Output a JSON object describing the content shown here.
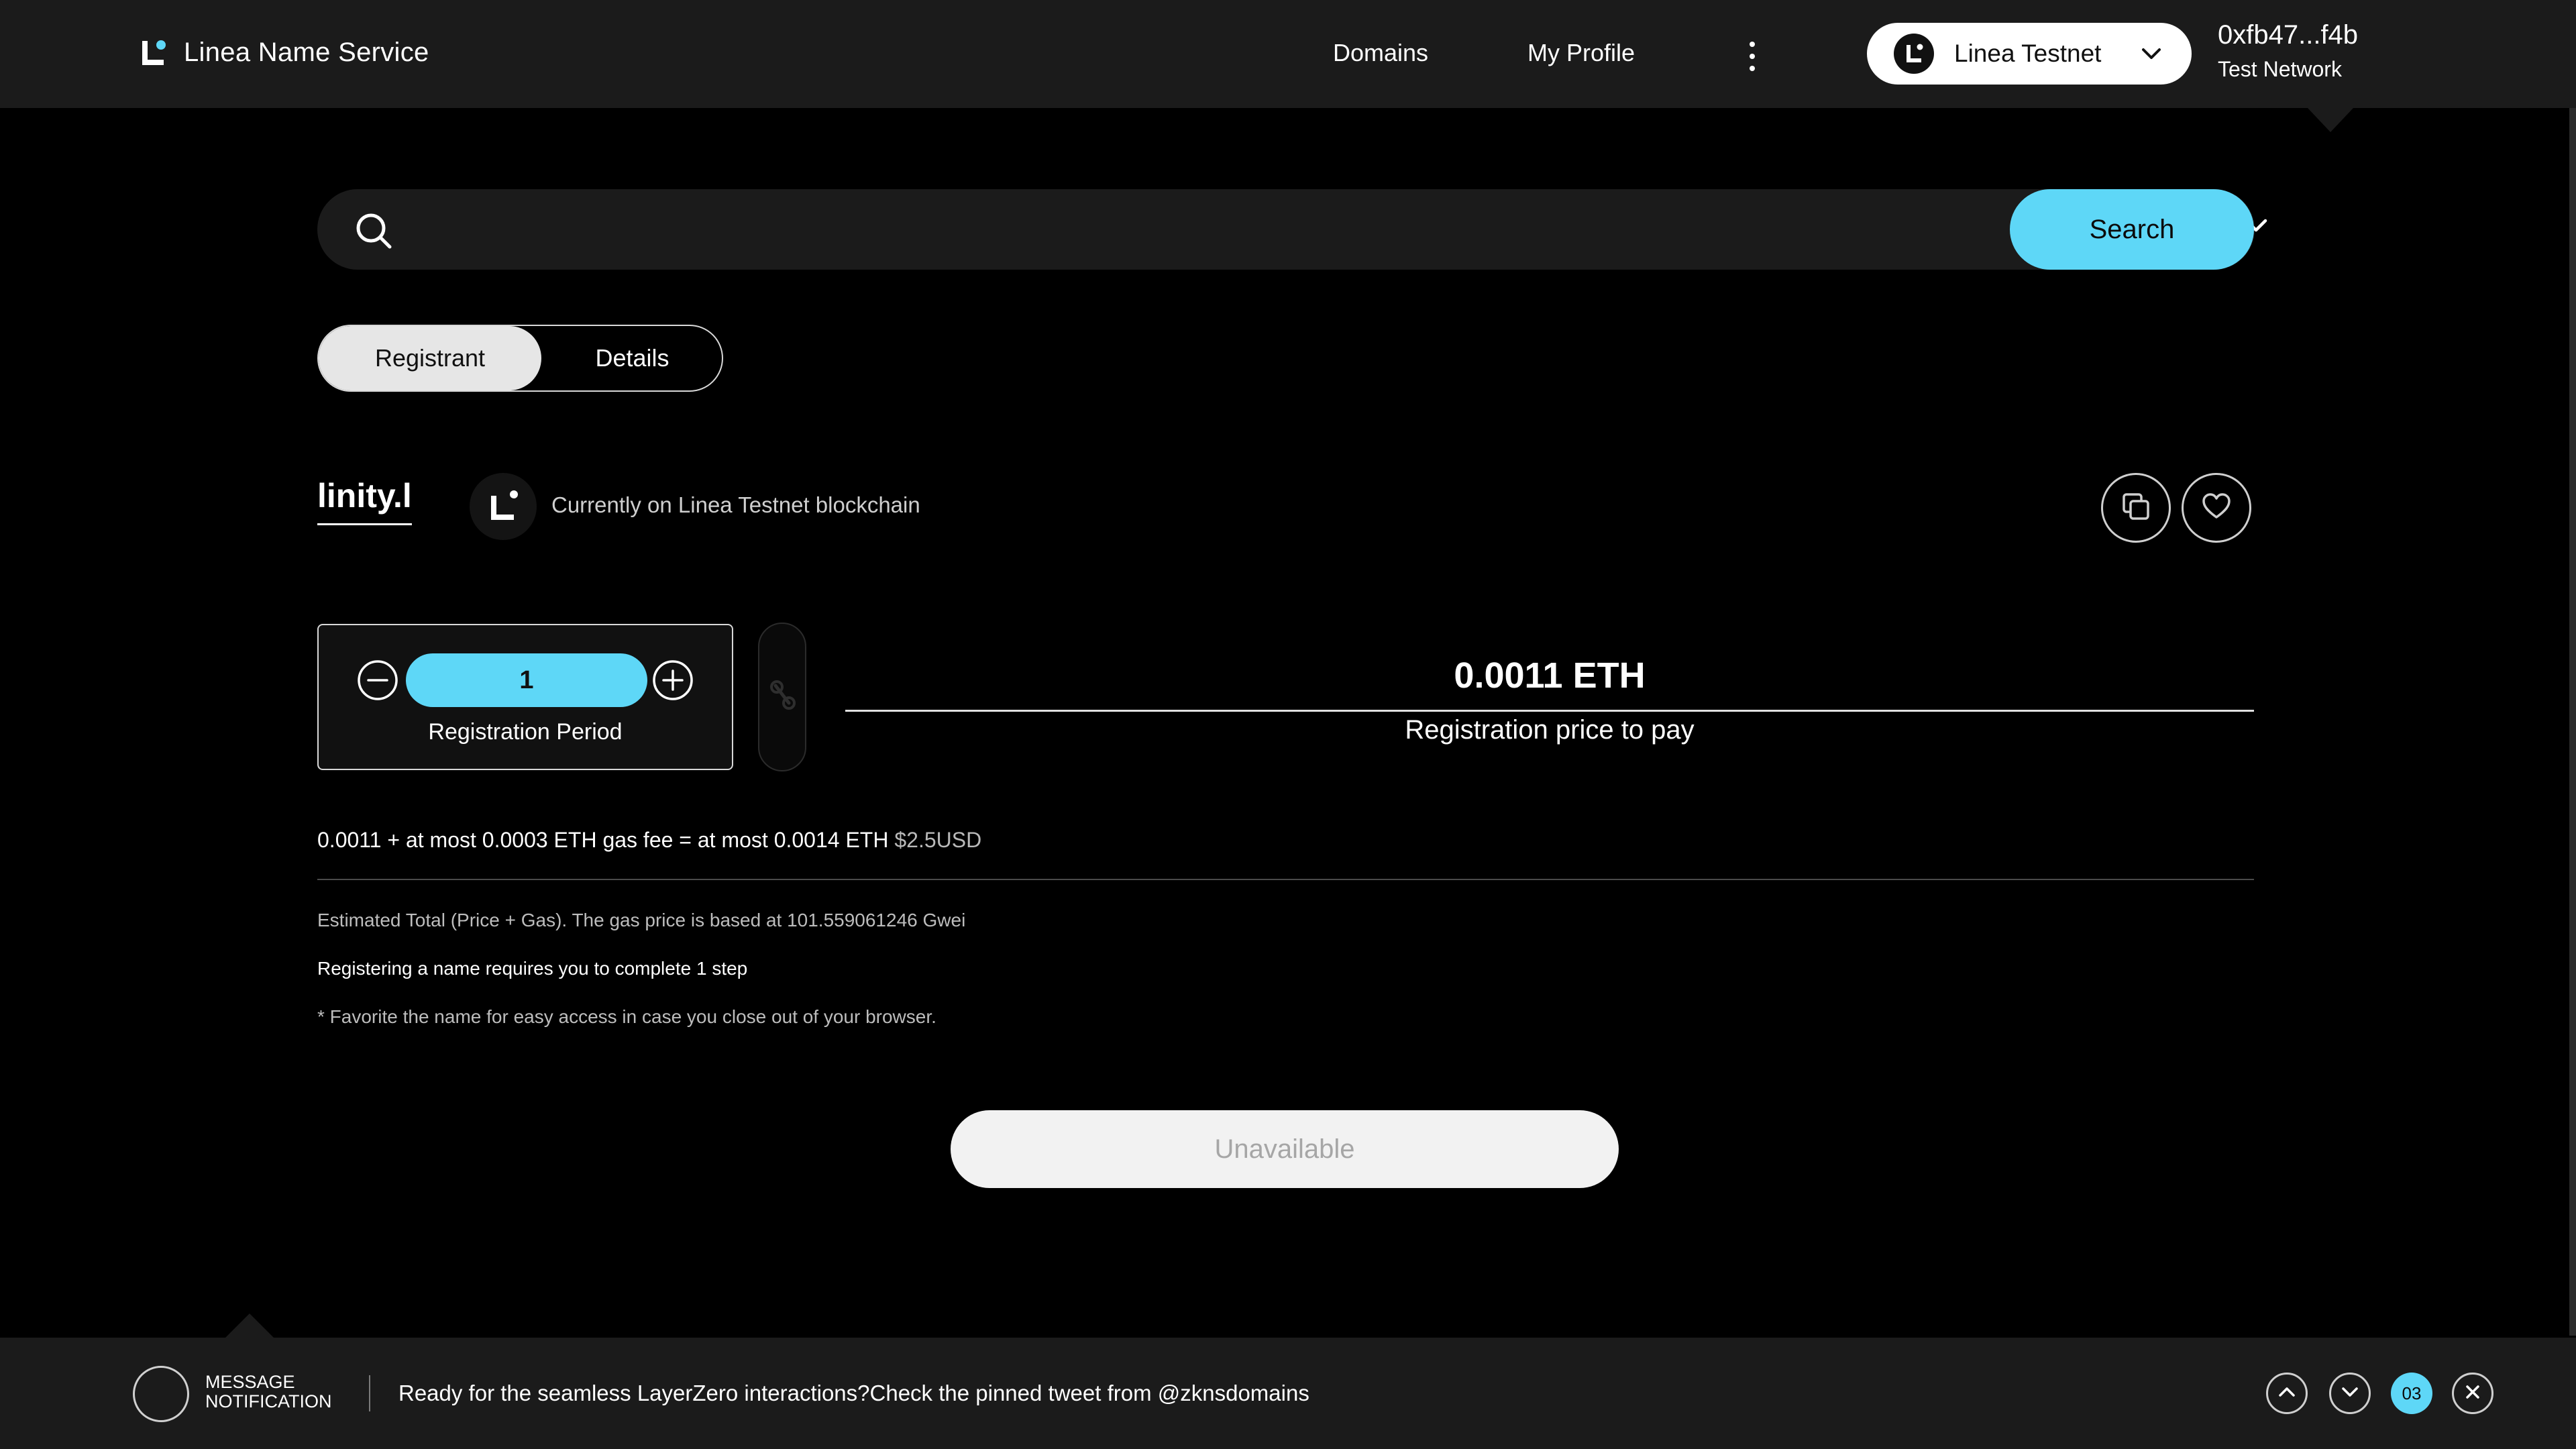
{
  "header": {
    "brand": "Linea Name Service",
    "nav": {
      "domains": "Domains",
      "profile": "My Profile"
    },
    "network_selector": {
      "label": "Linea Testnet"
    },
    "wallet": {
      "address": "0xfb47...f4b",
      "network": "Test Network"
    }
  },
  "search": {
    "query": "",
    "tld": ".l",
    "button_label": "Search"
  },
  "tabs": {
    "registrant": "Registrant",
    "details": "Details",
    "active": "Registrant"
  },
  "domain": {
    "name": "linity.l",
    "chain_text": "Currently on Linea Testnet blockchain"
  },
  "registration": {
    "period_value": "1",
    "period_label": "Registration Period",
    "price": "0.0011 ETH",
    "price_label": "Registration price to pay"
  },
  "fees": {
    "summary": "0.0011 + at most 0.0003 ETH gas fee = at most 0.0014 ETH",
    "usd": "$2.5USD",
    "gas_note": "Estimated Total (Price + Gas). The gas price is based at 101.559061246 Gwei",
    "steps_note": "Registering a name requires you to complete 1 step",
    "favorite_note": "* Favorite the name for easy access in case you close out of your browser."
  },
  "action": {
    "button_label": "Unavailable"
  },
  "notification": {
    "title_line1": "MESSAGE",
    "title_line2": "NOTIFICATION",
    "message": "Ready for the seamless LayerZero interactions?Check the pinned tweet from @zknsdomains",
    "count": "03"
  },
  "colors": {
    "accent": "#5ed7f7",
    "header_bg": "#1b1b1b",
    "page_bg": "#000000"
  }
}
